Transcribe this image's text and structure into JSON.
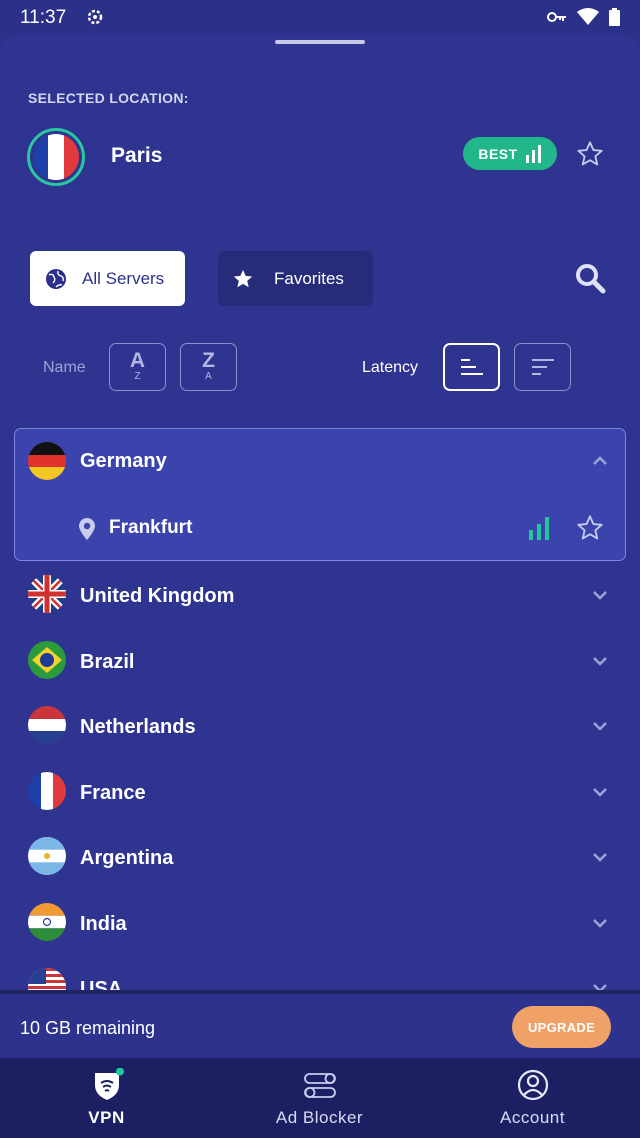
{
  "status_bar": {
    "time": "11:37"
  },
  "selected": {
    "label": "SELECTED LOCATION:",
    "city": "Paris",
    "badge": "BEST"
  },
  "tabs": {
    "all_servers": "All Servers",
    "favorites": "Favorites"
  },
  "sort": {
    "name_label": "Name",
    "az_big": "A",
    "az_small": "Z",
    "za_big": "Z",
    "za_small": "A",
    "latency_label": "Latency"
  },
  "countries": [
    {
      "name": "Germany",
      "expanded": true,
      "cities": [
        {
          "name": "Frankfurt"
        }
      ]
    },
    {
      "name": "United Kingdom"
    },
    {
      "name": "Brazil"
    },
    {
      "name": "Netherlands"
    },
    {
      "name": "France"
    },
    {
      "name": "Argentina"
    },
    {
      "name": "India"
    },
    {
      "name": "USA"
    }
  ],
  "plan": {
    "remaining": "10 GB remaining",
    "upgrade": "UPGRADE"
  },
  "nav": [
    {
      "label": "VPN"
    },
    {
      "label": "Ad Blocker"
    },
    {
      "label": "Account"
    }
  ],
  "colors": {
    "background": "#2b318a",
    "accent_green": "#22b78a",
    "upgrade_orange": "#f0a167",
    "nav_bg": "#1c2063"
  }
}
